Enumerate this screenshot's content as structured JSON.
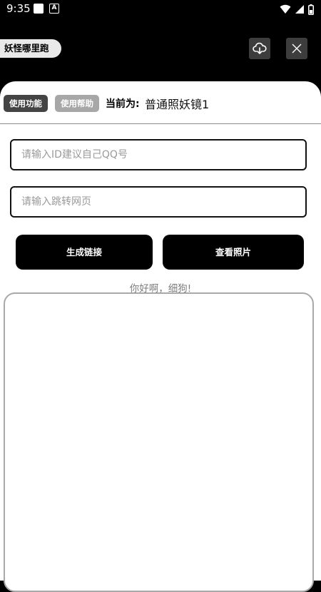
{
  "status_bar": {
    "time": "9:35",
    "notif_glyph": "A"
  },
  "header": {
    "app_name": "妖怪哪里跑"
  },
  "tabs": {
    "use_function": "使用功能",
    "use_help": "使用帮助"
  },
  "current": {
    "label": "当前为:",
    "value": "普通照妖镜1"
  },
  "inputs": {
    "id_placeholder": "请输入ID建议自己QQ号",
    "url_placeholder": "请输入跳转网页"
  },
  "buttons": {
    "generate": "生成链接",
    "view_photos": "查看照片"
  },
  "greeting": "你好啊，细狗!"
}
